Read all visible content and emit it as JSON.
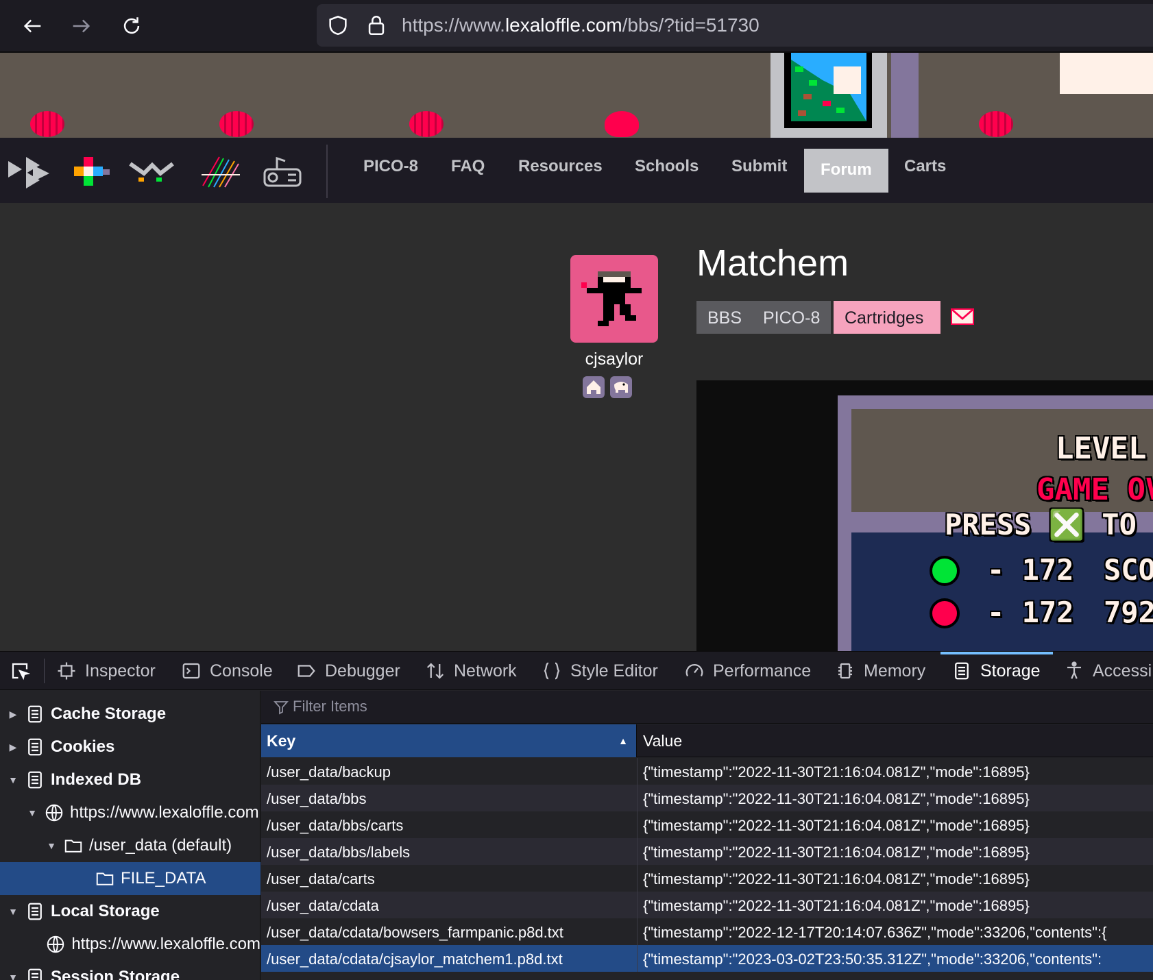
{
  "browser": {
    "url_prefix": "https://www.",
    "url_domain": "lexaloffle.com",
    "url_path": "/bbs/?tid=51730"
  },
  "site": {
    "nav": [
      "PICO-8",
      "FAQ",
      "Resources",
      "Schools",
      "Submit",
      "Forum",
      "Carts"
    ],
    "active_nav": "Forum"
  },
  "thread": {
    "title": "Matchem",
    "author": "cjsaylor",
    "breadcrumbs": [
      "BBS",
      "PICO-8",
      "Cartridges"
    ]
  },
  "game": {
    "line1": "LEVEL",
    "line2": "GAME OV",
    "line3": "PRESS ❎ TO",
    "row1_value": "- 172",
    "row1_extra": "SCO",
    "row2_value": "- 172",
    "row2_extra": "792"
  },
  "devtools": {
    "tabs": [
      "Inspector",
      "Console",
      "Debugger",
      "Network",
      "Style Editor",
      "Performance",
      "Memory",
      "Storage",
      "Accessi"
    ],
    "active_tab": "Storage",
    "tree": {
      "cache_storage": "Cache Storage",
      "cookies": "Cookies",
      "indexed_db": "Indexed DB",
      "idb_origin": "https://www.lexaloffle.com",
      "idb_db": "/user_data (default)",
      "idb_store": "FILE_DATA",
      "local_storage": "Local Storage",
      "ls_origin": "https://www.lexaloffle.com",
      "session_storage": "Session Storage"
    },
    "filter_placeholder": "Filter Items",
    "columns": {
      "key": "Key",
      "value": "Value"
    },
    "rows": [
      {
        "key": "/user_data/backup",
        "value": "{\"timestamp\":\"2022-11-30T21:16:04.081Z\",\"mode\":16895}"
      },
      {
        "key": "/user_data/bbs",
        "value": "{\"timestamp\":\"2022-11-30T21:16:04.081Z\",\"mode\":16895}"
      },
      {
        "key": "/user_data/bbs/carts",
        "value": "{\"timestamp\":\"2022-11-30T21:16:04.081Z\",\"mode\":16895}"
      },
      {
        "key": "/user_data/bbs/labels",
        "value": "{\"timestamp\":\"2022-11-30T21:16:04.081Z\",\"mode\":16895}"
      },
      {
        "key": "/user_data/carts",
        "value": "{\"timestamp\":\"2022-11-30T21:16:04.081Z\",\"mode\":16895}"
      },
      {
        "key": "/user_data/cdata",
        "value": "{\"timestamp\":\"2022-11-30T21:16:04.081Z\",\"mode\":16895}"
      },
      {
        "key": "/user_data/cdata/bowsers_farmpanic.p8d.txt",
        "value": "{\"timestamp\":\"2022-12-17T20:14:07.636Z\",\"mode\":33206,\"contents\":{"
      },
      {
        "key": "/user_data/cdata/cjsaylor_matchem1.p8d.txt",
        "value": "{\"timestamp\":\"2023-03-02T23:50:35.312Z\",\"mode\":33206,\"contents\":"
      }
    ]
  },
  "colors": {
    "accent": "#234b87",
    "avatar_bg": "#e8588b",
    "crumb_active": "#f6a3bd",
    "crumb_bg": "#5a5a5e"
  },
  "icons": [
    "back-icon",
    "forward-icon",
    "reload-icon",
    "shield-icon",
    "lock-icon",
    "mail-icon",
    "home-icon",
    "elephant-icon",
    "pick-element-icon",
    "globe-icon",
    "folder-icon",
    "database-icon"
  ]
}
